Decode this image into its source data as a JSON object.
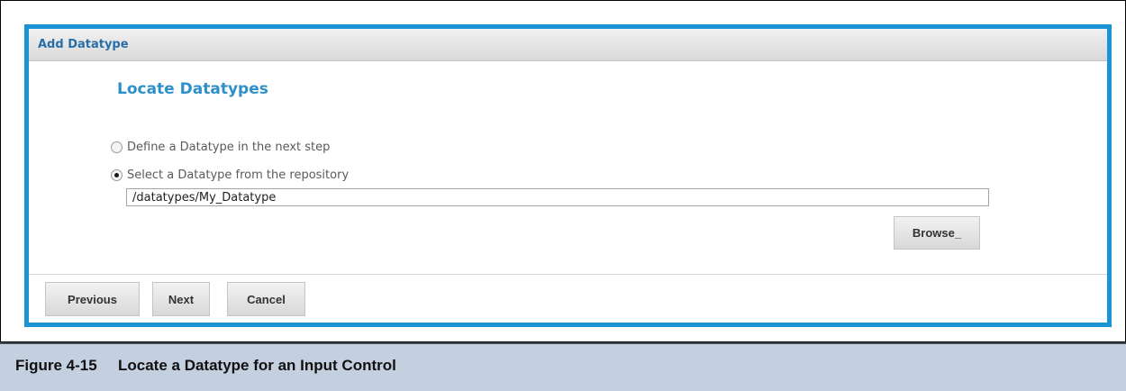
{
  "dialog": {
    "title": "Add Datatype",
    "heading": "Locate Datatypes",
    "options": [
      {
        "label": "Define a Datatype in the next step",
        "selected": false
      },
      {
        "label": "Select a Datatype from the repository",
        "selected": true
      }
    ],
    "path_value": "/datatypes/My_Datatype",
    "browse_label": "Browse_",
    "buttons": {
      "previous": "Previous",
      "next": "Next",
      "cancel": "Cancel"
    },
    "accent_color": "#1c93d2"
  },
  "caption": {
    "number": "Figure 4-15",
    "text": "Locate a Datatype for an Input Control",
    "background": "#c4cfe0"
  }
}
